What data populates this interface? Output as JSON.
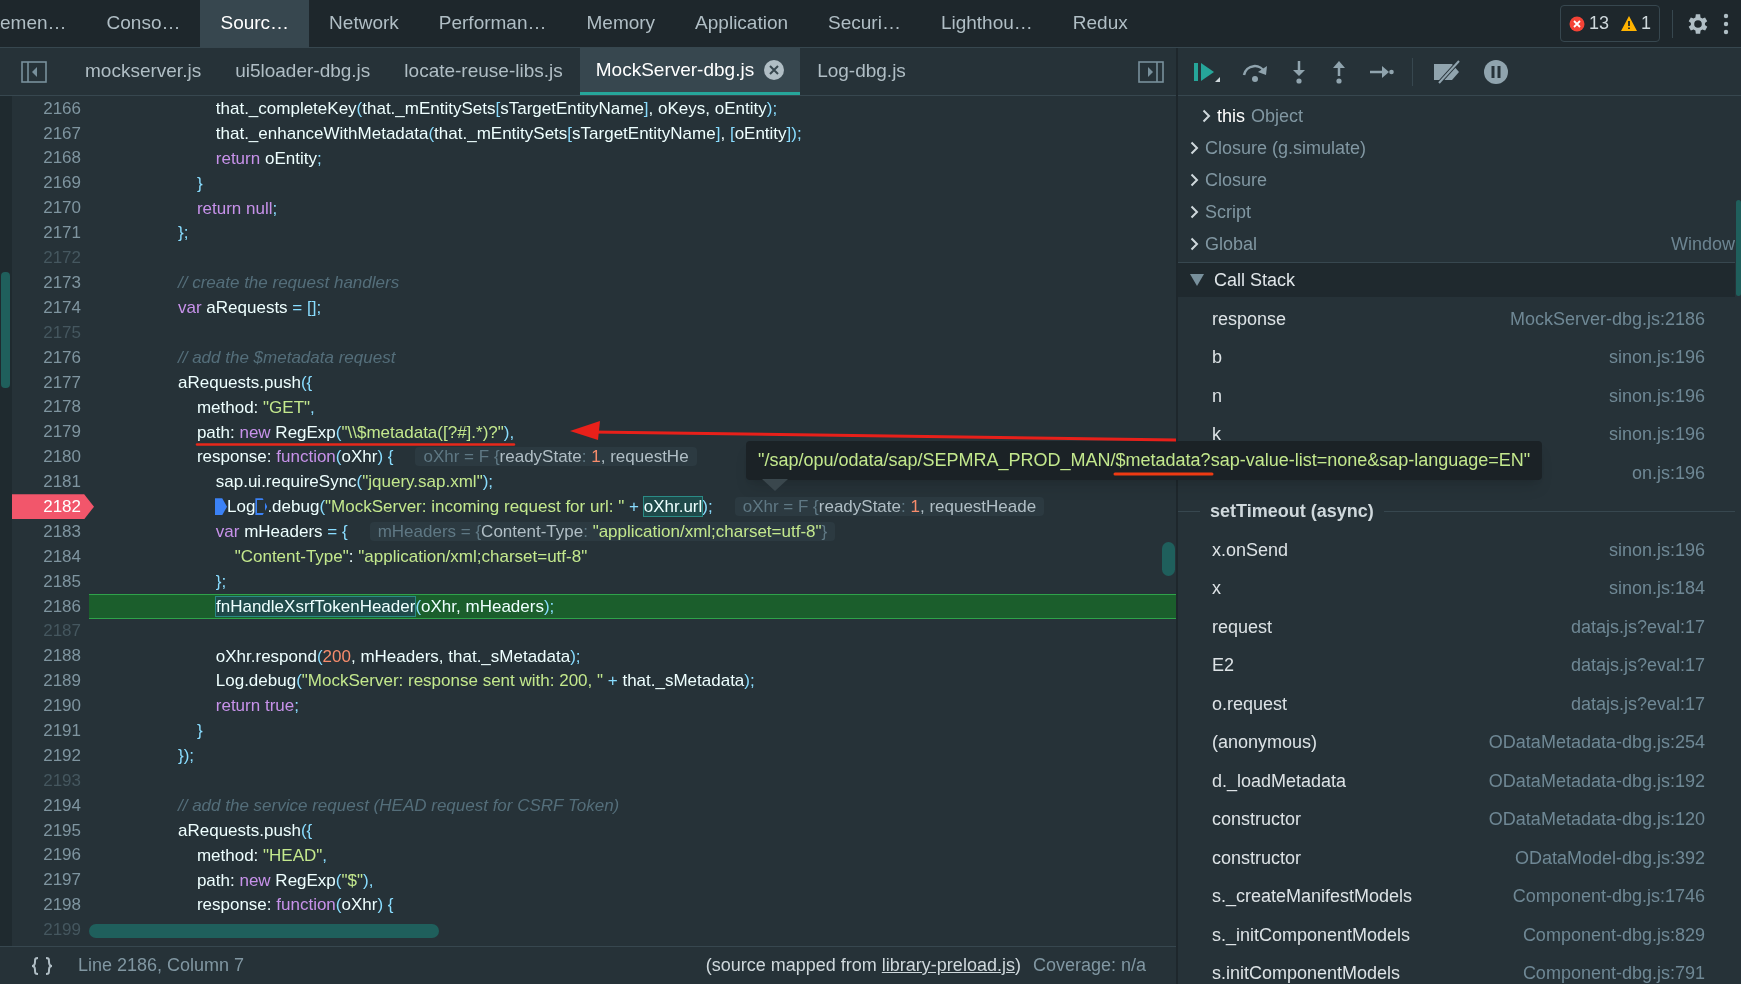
{
  "top_tabs": [
    {
      "label": "emen…",
      "selected": false
    },
    {
      "label": "Conso…",
      "selected": false
    },
    {
      "label": "Sourc…",
      "selected": true
    },
    {
      "label": "Network",
      "selected": false
    },
    {
      "label": "Performan…",
      "selected": false
    },
    {
      "label": "Memory",
      "selected": false
    },
    {
      "label": "Application",
      "selected": false
    },
    {
      "label": "Securi…",
      "selected": false
    },
    {
      "label": "Lighthou…",
      "selected": false
    },
    {
      "label": "Redux",
      "selected": false
    }
  ],
  "issues": {
    "errors": "13",
    "warnings": "1"
  },
  "file_tabs": [
    {
      "label": "mockserver.js",
      "selected": false
    },
    {
      "label": "ui5loader-dbg.js",
      "selected": false
    },
    {
      "label": "locate-reuse-libs.js",
      "selected": false
    },
    {
      "label": "MockServer-dbg.js",
      "selected": true
    },
    {
      "label": "Log-dbg.js",
      "selected": false
    }
  ],
  "lines": [
    {
      "number": "2166",
      "breakpoint": false,
      "current": false,
      "code": [
        {
          "text": "        that._completeKey",
          "kind": "plain"
        },
        {
          "text": "(",
          "kind": "punct"
        },
        {
          "text": "that._mEntitySets",
          "kind": "plain"
        },
        {
          "text": "[",
          "kind": "punct"
        },
        {
          "text": "sTargetEntityName",
          "kind": "plain"
        },
        {
          "text": "]",
          "kind": "punct"
        },
        {
          "text": ", oKeys, oEntity",
          "kind": "plain"
        },
        {
          "text": ");",
          "kind": "punct"
        }
      ]
    },
    {
      "number": "2167",
      "breakpoint": false,
      "current": false,
      "code": [
        {
          "text": "        that._enhanceWithMetadata",
          "kind": "plain"
        },
        {
          "text": "(",
          "kind": "punct"
        },
        {
          "text": "that._mEntitySets",
          "kind": "plain"
        },
        {
          "text": "[",
          "kind": "punct"
        },
        {
          "text": "sTargetEntityName",
          "kind": "plain"
        },
        {
          "text": "]",
          "kind": "punct"
        },
        {
          "text": ", ",
          "kind": "plain"
        },
        {
          "text": "[",
          "kind": "punct"
        },
        {
          "text": "oEntity",
          "kind": "plain"
        },
        {
          "text": "]);",
          "kind": "punct"
        }
      ]
    },
    {
      "number": "2168",
      "breakpoint": false,
      "current": false,
      "code": [
        {
          "text": "        return",
          "kind": "keyword"
        },
        {
          "text": " oEntity",
          "kind": "plain"
        },
        {
          "text": ";",
          "kind": "punct"
        }
      ]
    },
    {
      "number": "2169",
      "breakpoint": false,
      "current": false,
      "code": [
        {
          "text": "    }",
          "kind": "punct"
        }
      ]
    },
    {
      "number": "2170",
      "breakpoint": false,
      "current": false,
      "code": [
        {
          "text": "    return null",
          "kind": "keyword"
        },
        {
          "text": ";",
          "kind": "punct"
        }
      ]
    },
    {
      "number": "2171",
      "breakpoint": false,
      "current": false,
      "code": [
        {
          "text": "};",
          "kind": "punct"
        }
      ]
    },
    {
      "number": "2172",
      "breakpoint": false,
      "current": false
    },
    {
      "number": "2173",
      "breakpoint": false,
      "current": false,
      "code": [
        {
          "text": "// create the request handlers",
          "kind": "comment"
        }
      ]
    },
    {
      "number": "2174",
      "breakpoint": false,
      "current": false,
      "code": [
        {
          "text": "var",
          "kind": "keyword"
        },
        {
          "text": " aRequests ",
          "kind": "plain"
        },
        {
          "text": "= [];",
          "kind": "punct"
        }
      ]
    },
    {
      "number": "2175",
      "breakpoint": false,
      "current": false
    },
    {
      "number": "2176",
      "breakpoint": false,
      "current": false,
      "code": [
        {
          "text": "// add the $metadata request",
          "kind": "comment"
        }
      ]
    },
    {
      "number": "2177",
      "breakpoint": false,
      "current": false,
      "code": [
        {
          "text": "aRequests.push",
          "kind": "plain"
        },
        {
          "text": "({",
          "kind": "punct"
        }
      ]
    },
    {
      "number": "2178",
      "breakpoint": false,
      "current": false,
      "code": [
        {
          "text": "    method: ",
          "kind": "plain"
        },
        {
          "text": "\"GET\"",
          "kind": "string"
        },
        {
          "text": ",",
          "kind": "punct"
        }
      ]
    },
    {
      "number": "2179",
      "breakpoint": false,
      "current": false,
      "code": [
        {
          "text": "    path: ",
          "kind": "plain"
        },
        {
          "text": "new",
          "kind": "keyword"
        },
        {
          "text": " RegExp",
          "kind": "plain"
        },
        {
          "text": "(",
          "kind": "punct"
        },
        {
          "text": "\"\\\\$metadata([?#].*)?\"",
          "kind": "string"
        },
        {
          "text": "),",
          "kind": "punct"
        }
      ]
    },
    {
      "number": "2180",
      "breakpoint": false,
      "current": false,
      "code": [
        {
          "text": "    response: ",
          "kind": "plain"
        },
        {
          "text": "function",
          "kind": "keyword"
        },
        {
          "text": "(",
          "kind": "punct"
        },
        {
          "text": "oXhr",
          "kind": "plain"
        },
        {
          "text": ") {",
          "kind": "punct"
        }
      ],
      "hint": [
        {
          "text": "oXhr = F {",
          "kind": "dim"
        },
        {
          "text": "readyState",
          "kind": "plain"
        },
        {
          "text": ": ",
          "kind": "dim"
        },
        {
          "text": "1",
          "kind": "number"
        },
        {
          "text": ", requestHe",
          "kind": "plain"
        }
      ]
    },
    {
      "number": "2181",
      "breakpoint": false,
      "current": false,
      "code": [
        {
          "text": "        sap.ui.requireSync",
          "kind": "plain"
        },
        {
          "text": "(",
          "kind": "punct"
        },
        {
          "text": "\"jquery.sap.xml\"",
          "kind": "string"
        },
        {
          "text": ");",
          "kind": "punct"
        }
      ]
    },
    {
      "number": "2182",
      "breakpoint": true,
      "current": false,
      "code": [
        {
          "kind": "inline-breakpoint",
          "active": true
        },
        {
          "text": "Log",
          "kind": "plain"
        },
        {
          "kind": "inline-breakpoint",
          "active": false
        },
        {
          "text": ".debug",
          "kind": "plain"
        },
        {
          "text": "(",
          "kind": "punct"
        },
        {
          "text": "\"MockServer: incoming request for url: \"",
          "kind": "string"
        },
        {
          "text": " + ",
          "kind": "punct"
        },
        {
          "text": "oXhr.url",
          "kind": "highlight"
        },
        {
          "text": ");",
          "kind": "punct"
        }
      ],
      "hint": [
        {
          "text": "oXhr = F {",
          "kind": "dim"
        },
        {
          "text": "readyState",
          "kind": "plain"
        },
        {
          "text": ": ",
          "kind": "dim"
        },
        {
          "text": "1",
          "kind": "number"
        },
        {
          "text": ", requestHeade",
          "kind": "plain"
        }
      ]
    },
    {
      "number": "2183",
      "breakpoint": false,
      "current": false,
      "code": [
        {
          "text": "        var",
          "kind": "keyword"
        },
        {
          "text": " mHeaders ",
          "kind": "plain"
        },
        {
          "text": "= {",
          "kind": "punct"
        }
      ],
      "hint": [
        {
          "text": "mHeaders = {",
          "kind": "dim"
        },
        {
          "text": "Content-Type",
          "kind": "plain"
        },
        {
          "text": ": ",
          "kind": "dim"
        },
        {
          "text": "\"application/xml;charset=utf-8\"",
          "kind": "string"
        },
        {
          "text": "}",
          "kind": "dim"
        }
      ]
    },
    {
      "number": "2184",
      "breakpoint": false,
      "current": false,
      "code": [
        {
          "text": "            \"Content-Type\"",
          "kind": "string"
        },
        {
          "text": ": ",
          "kind": "plain"
        },
        {
          "text": "\"application/xml;charset=utf-8\"",
          "kind": "string"
        }
      ]
    },
    {
      "number": "2185",
      "breakpoint": false,
      "current": false,
      "code": [
        {
          "text": "        };",
          "kind": "punct"
        }
      ]
    },
    {
      "number": "2186",
      "breakpoint": false,
      "current": true,
      "code": [
        {
          "text": "fnHandleXsrfTokenHeader",
          "kind": "highlight"
        },
        {
          "text": "(",
          "kind": "punct"
        },
        {
          "text": "oXhr, mHeaders",
          "kind": "plain"
        },
        {
          "text": ");",
          "kind": "punct"
        }
      ]
    },
    {
      "number": "2187",
      "breakpoint": false,
      "current": false
    },
    {
      "number": "2188",
      "breakpoint": false,
      "current": false,
      "code": [
        {
          "text": "        oXhr.respond",
          "kind": "plain"
        },
        {
          "text": "(",
          "kind": "punct"
        },
        {
          "text": "200",
          "kind": "number"
        },
        {
          "text": ", mHeaders, that._sMetadata",
          "kind": "plain"
        },
        {
          "text": ");",
          "kind": "punct"
        }
      ]
    },
    {
      "number": "2189",
      "breakpoint": false,
      "current": false,
      "code": [
        {
          "text": "        Log.debug",
          "kind": "plain"
        },
        {
          "text": "(",
          "kind": "punct"
        },
        {
          "text": "\"MockServer: response sent with: 200, \"",
          "kind": "string"
        },
        {
          "text": " + ",
          "kind": "punct"
        },
        {
          "text": "that._sMetadata",
          "kind": "plain"
        },
        {
          "text": ");",
          "kind": "punct"
        }
      ]
    },
    {
      "number": "2190",
      "breakpoint": false,
      "current": false,
      "code": [
        {
          "text": "        return true",
          "kind": "keyword"
        },
        {
          "text": ";",
          "kind": "punct"
        }
      ]
    },
    {
      "number": "2191",
      "breakpoint": false,
      "current": false,
      "code": [
        {
          "text": "    }",
          "kind": "punct"
        }
      ]
    },
    {
      "number": "2192",
      "breakpoint": false,
      "current": false,
      "code": [
        {
          "text": "});",
          "kind": "punct"
        }
      ]
    },
    {
      "number": "2193",
      "breakpoint": false,
      "current": false
    },
    {
      "number": "2194",
      "breakpoint": false,
      "current": false,
      "code": [
        {
          "text": "// add the service request (HEAD request for CSRF Token)",
          "kind": "comment"
        }
      ]
    },
    {
      "number": "2195",
      "breakpoint": false,
      "current": false,
      "code": [
        {
          "text": "aRequests.push",
          "kind": "plain"
        },
        {
          "text": "({",
          "kind": "punct"
        }
      ]
    },
    {
      "number": "2196",
      "breakpoint": false,
      "current": false,
      "code": [
        {
          "text": "    method: ",
          "kind": "plain"
        },
        {
          "text": "\"HEAD\"",
          "kind": "string"
        },
        {
          "text": ",",
          "kind": "punct"
        }
      ]
    },
    {
      "number": "2197",
      "breakpoint": false,
      "current": false,
      "code": [
        {
          "text": "    path: ",
          "kind": "plain"
        },
        {
          "text": "new",
          "kind": "keyword"
        },
        {
          "text": " RegExp",
          "kind": "plain"
        },
        {
          "text": "(",
          "kind": "punct"
        },
        {
          "text": "\"$\"",
          "kind": "string"
        },
        {
          "text": "),",
          "kind": "punct"
        }
      ]
    },
    {
      "number": "2198",
      "breakpoint": false,
      "current": false,
      "code": [
        {
          "text": "    response: ",
          "kind": "plain"
        },
        {
          "text": "function",
          "kind": "keyword"
        },
        {
          "text": "(",
          "kind": "punct"
        },
        {
          "text": "oXhr",
          "kind": "plain"
        },
        {
          "text": ") {",
          "kind": "punct"
        }
      ]
    },
    {
      "number": "2199",
      "breakpoint": false,
      "current": false
    }
  ],
  "tooltip": "\"/sap/opu/odata/sap/SEPMRA_PROD_MAN/$metadata?sap-value-list=none&sap-language=EN\"",
  "status_bar": {
    "position": "Line 2186, Column 7",
    "source_prefix": "(source mapped from ",
    "source_link": "library-preload.js",
    "source_suffix": ")",
    "coverage": "Coverage: n/a"
  },
  "scope": [
    {
      "name": "this",
      "value": "Object",
      "kind": "property",
      "expanded": false
    },
    {
      "name": "Closure (g.simulate)",
      "kind": "section",
      "expanded": false
    },
    {
      "name": "Closure",
      "kind": "section",
      "expanded": false
    },
    {
      "name": "Script",
      "kind": "section",
      "expanded": false
    },
    {
      "name": "Global",
      "value": "Window",
      "kind": "section",
      "expanded": false
    }
  ],
  "call_stack": {
    "title": "Call Stack",
    "expanded": true,
    "frames": [
      {
        "kind": "frame",
        "function": "response",
        "location": "MockServer-dbg.js:2186"
      },
      {
        "kind": "frame",
        "function": "b",
        "location": "sinon.js:196"
      },
      {
        "kind": "frame",
        "function": "n",
        "location": "sinon.js:196"
      },
      {
        "kind": "frame",
        "function": "k",
        "location": "sinon.js:196"
      },
      {
        "kind": "frame",
        "location": "on.js:196"
      },
      {
        "kind": "async",
        "function": "setTimeout (async)"
      },
      {
        "kind": "frame",
        "function": "x.onSend",
        "location": "sinon.js:196"
      },
      {
        "kind": "frame",
        "function": "x",
        "location": "sinon.js:184"
      },
      {
        "kind": "frame",
        "function": "request",
        "location": "datajs.js?eval:17"
      },
      {
        "kind": "frame",
        "function": "E2",
        "location": "datajs.js?eval:17"
      },
      {
        "kind": "frame",
        "function": "o.request",
        "location": "datajs.js?eval:17"
      },
      {
        "kind": "frame",
        "function": "(anonymous)",
        "location": "ODataMetadata-dbg.js:254"
      },
      {
        "kind": "frame",
        "function": "d._loadMetadata",
        "location": "ODataMetadata-dbg.js:192"
      },
      {
        "kind": "frame",
        "function": "constructor",
        "location": "ODataMetadata-dbg.js:120"
      },
      {
        "kind": "frame",
        "function": "constructor",
        "location": "ODataModel-dbg.js:392"
      },
      {
        "kind": "frame",
        "function": "s._createManifestModels",
        "location": "Component-dbg.js:1746"
      },
      {
        "kind": "frame",
        "function": "s._initComponentModels",
        "location": "Component-dbg.js:829"
      },
      {
        "kind": "frame",
        "function": "s.initComponentModels",
        "location": "Component-dbg.js:791"
      }
    ]
  }
}
